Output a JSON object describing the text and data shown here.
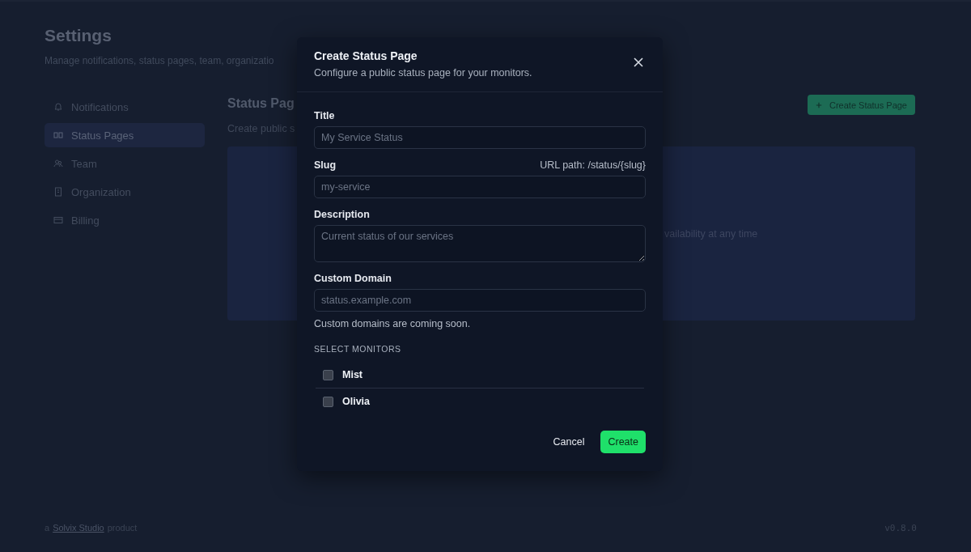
{
  "page": {
    "title": "Settings",
    "subtitle": "Manage notifications, status pages, team, organizatio"
  },
  "sidebar": {
    "items": [
      {
        "label": "Notifications",
        "selected": false
      },
      {
        "label": "Status Pages",
        "selected": true
      },
      {
        "label": "Team",
        "selected": false
      },
      {
        "label": "Organization",
        "selected": false
      },
      {
        "label": "Billing",
        "selected": false
      }
    ]
  },
  "section": {
    "title": "Status Pag",
    "subtitle": "Create public s",
    "create_button": "Create Status Page",
    "empty_text": "vailability at any time"
  },
  "footer": {
    "prefix": "a",
    "link": "Solvix Studio",
    "suffix": "product",
    "version": "v0.8.0"
  },
  "dialog": {
    "title": "Create Status Page",
    "subtitle": "Configure a public status page for your monitors.",
    "fields": [
      {
        "kind": "input",
        "label": "Title",
        "placeholder": "My Service Status"
      },
      {
        "kind": "input",
        "label": "Slug",
        "hint_right": "URL path: /status/{slug}",
        "placeholder": "my-service"
      },
      {
        "kind": "textarea",
        "label": "Description",
        "placeholder": "Current status of our services"
      },
      {
        "kind": "input",
        "label": "Custom Domain",
        "placeholder": "status.example.com",
        "help": "Custom domains are coming soon."
      }
    ],
    "monitors_heading": "SELECT MONITORS",
    "monitors": [
      {
        "name": "Mist",
        "checked": false
      },
      {
        "name": "Olivia",
        "checked": false
      }
    ],
    "buttons": {
      "cancel": "Cancel",
      "create": "Create"
    }
  }
}
